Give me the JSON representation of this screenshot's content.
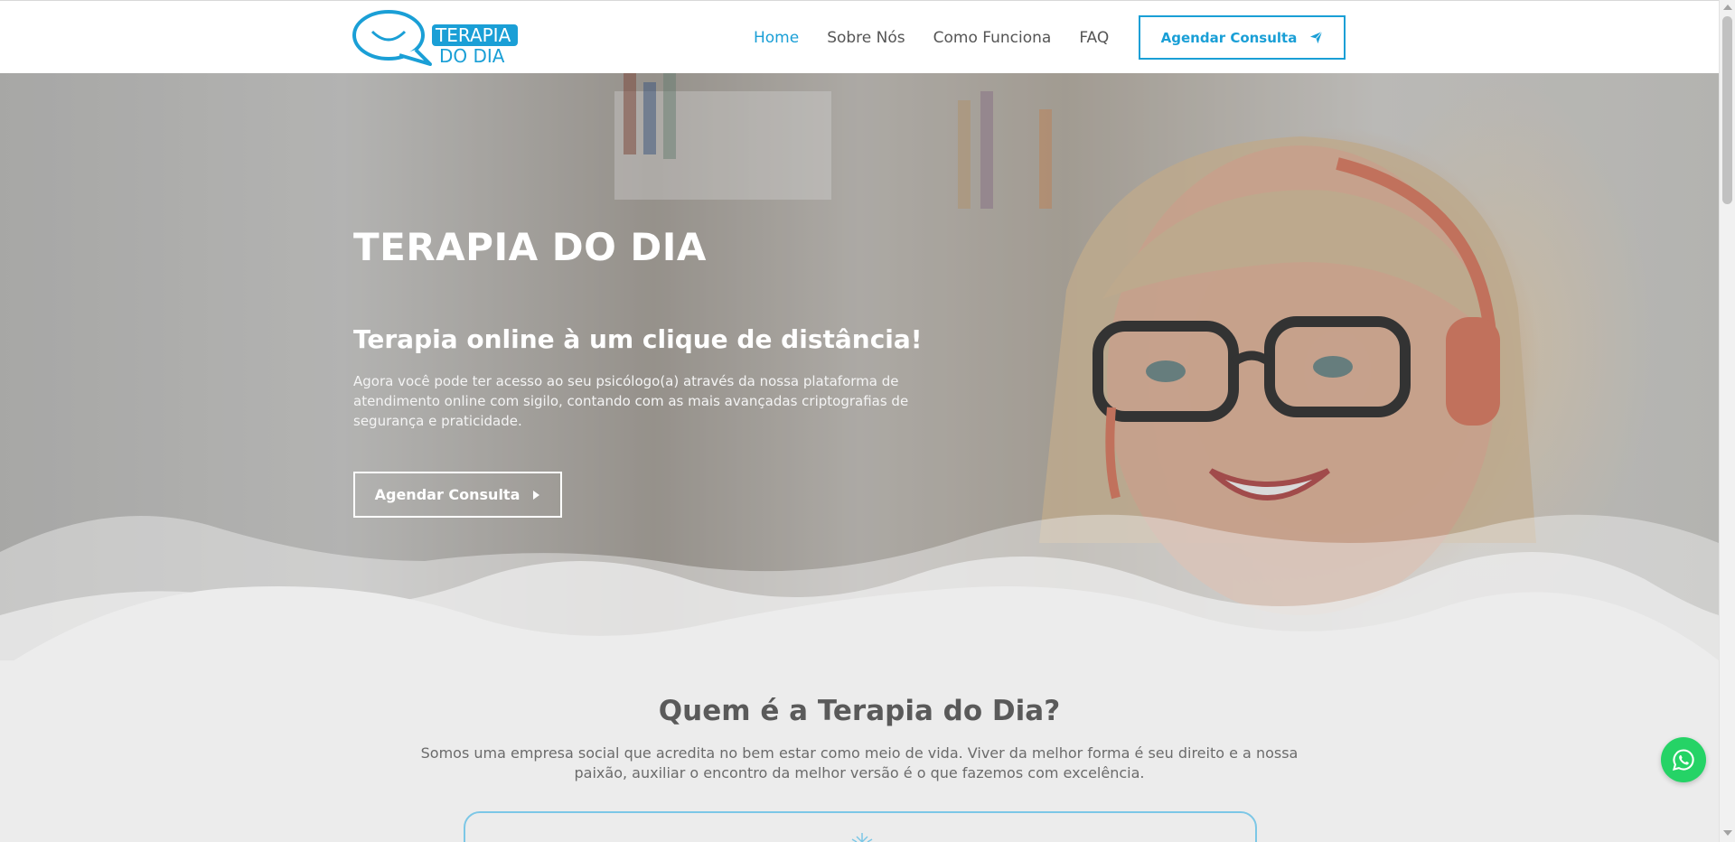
{
  "header": {
    "logo": {
      "line1": "TERAPIA",
      "line2": "DO DIA"
    },
    "nav": [
      {
        "label": "Home",
        "active": true
      },
      {
        "label": "Sobre Nós",
        "active": false
      },
      {
        "label": "Como Funciona",
        "active": false
      },
      {
        "label": "FAQ",
        "active": false
      }
    ],
    "cta_label": "Agendar Consulta",
    "cta_icon": "paper-plane-icon"
  },
  "hero": {
    "title": "TERAPIA DO DIA",
    "subtitle": "Terapia online à um clique de distância!",
    "text": "Agora você pode ter acesso ao seu psicólogo(a) através da nossa plataforma de atendimento online com sigilo, contando com as mais avançadas criptografias de segurança e praticidade.",
    "button_label": "Agendar Consulta",
    "button_icon": "caret-right-icon"
  },
  "about": {
    "title": "Quem é a Terapia do Dia?",
    "text": "Somos uma empresa social que acredita no bem estar como meio de vida. Viver da melhor forma é seu direito e a nossa paixão, auxiliar o encontro da melhor versão é o que fazemos com excelência."
  },
  "floating": {
    "icon": "whatsapp-icon"
  },
  "colors": {
    "accent": "#1a9fd6",
    "whatsapp": "#25d366",
    "heading": "#5a5a5a",
    "section_bg": "#ececec"
  }
}
